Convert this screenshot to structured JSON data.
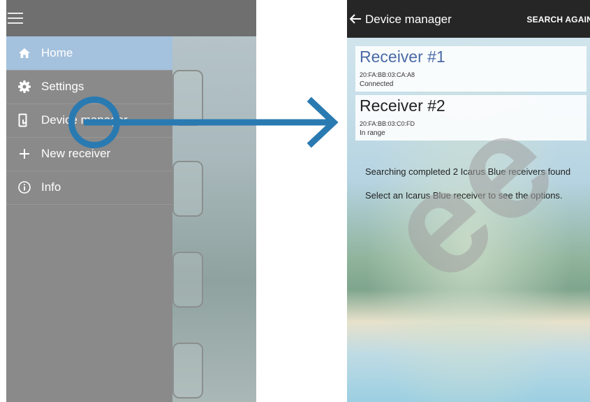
{
  "left_screen": {
    "menu": [
      {
        "label": "Home",
        "icon": "home-icon",
        "active": true
      },
      {
        "label": "Settings",
        "icon": "gear-icon",
        "active": false
      },
      {
        "label": "Device manager",
        "icon": "device-manager-icon",
        "active": false
      },
      {
        "label": "New receiver",
        "icon": "plus-icon",
        "active": false
      },
      {
        "label": "Info",
        "icon": "info-icon",
        "active": false
      }
    ],
    "colors": {
      "drawer": "#8a8a8a",
      "active": "#a4c1dd",
      "highlight": "#2a7ab2"
    }
  },
  "right_screen": {
    "title": "Device manager",
    "search_again_label": "SEARCH AGAIN",
    "receivers": [
      {
        "name": "Receiver #1",
        "mac": "20:FA:BB:03:CA:A8",
        "status": "Connected"
      },
      {
        "name": "Receiver #2",
        "mac": "20:FA:BB:03:C0:FD",
        "status": "In range"
      }
    ],
    "status_message": "Searching completed 2 Icarus Blue receivers found",
    "hint_message": "Select an Icarus Blue receiver to see the options.",
    "colors": {
      "appbar": "#262626",
      "receiver_title": "#4a6aa6"
    }
  },
  "watermark": "ee"
}
